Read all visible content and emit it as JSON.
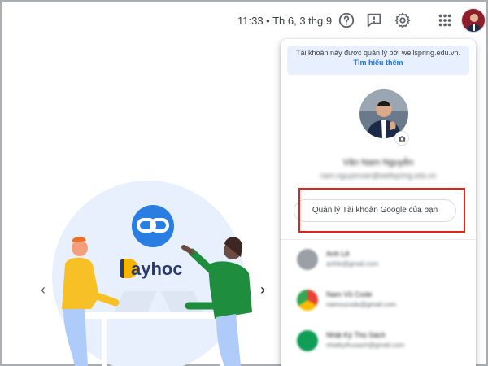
{
  "header": {
    "time": "11:33 • Th 6, 3 thg 9",
    "icons": [
      "help-icon",
      "feedback-icon",
      "settings-icon",
      "apps-icon",
      "avatar"
    ]
  },
  "illustration": {
    "brand": "ayhoc",
    "brand_color": "#1a73e8"
  },
  "account_panel": {
    "managed_notice": "Tài khoản này được quản lý bởi wellspring.edu.vn.",
    "learn_more": "Tìm hiểu thêm",
    "user_name": "Văn Nam Nguyễn",
    "user_email": "nam.nguyenvan@wellspring.edu.vn",
    "manage_button": "Quản lý Tài khoản Google của bạn",
    "other_accounts": [
      {
        "name": "Anh Lê",
        "email": "anhle@gmail.com",
        "color": "#5f6368"
      },
      {
        "name": "Nam Vũ Code",
        "email": "namvucode@gmail.com",
        "color": "#e8453c"
      },
      {
        "name": "Nhật Ký Thú Sách",
        "email": "nhatkythusach@gmail.com",
        "color": "#0f9d58"
      }
    ]
  },
  "colors": {
    "highlight": "#e2231a",
    "panel_notice_bg": "#e8f0fe",
    "link": "#1a73e8"
  }
}
